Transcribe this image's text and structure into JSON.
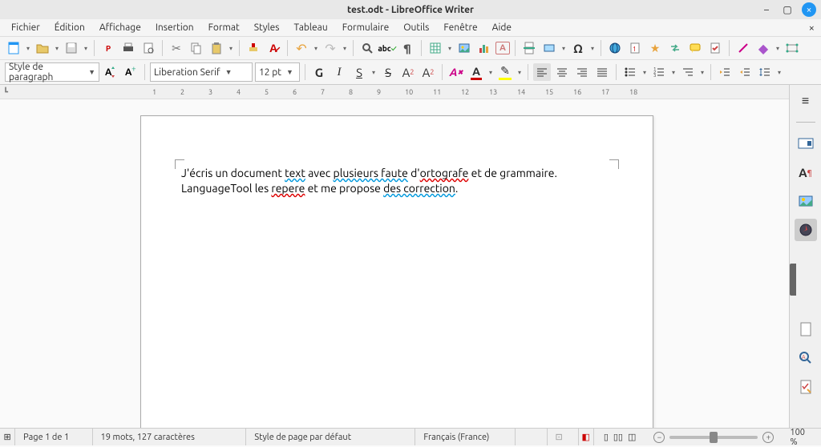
{
  "window": {
    "title": "test.odt - LibreOffice Writer",
    "minimize": "–",
    "maximize": "▢",
    "close": "×"
  },
  "menu": {
    "items": [
      "Fichier",
      "Édition",
      "Affichage",
      "Insertion",
      "Format",
      "Styles",
      "Tableau",
      "Formulaire",
      "Outils",
      "Fenêtre",
      "Aide"
    ],
    "close_doc": "×"
  },
  "format": {
    "para_style": "Style de paragraph",
    "font_name": "Liberation Serif",
    "font_size": "12 pt",
    "bold": "G",
    "italic": "I",
    "underline": "S",
    "strike": "S",
    "superscript": "A",
    "sup2": "2",
    "subscript": "A",
    "sub2": "2",
    "highlight_a": "A",
    "fontcolor_a": "A",
    "hilite": "✎"
  },
  "ruler": {
    "corner": "┗",
    "numbers": [
      "1",
      "2",
      "3",
      "4",
      "5",
      "6",
      "7",
      "8",
      "9",
      "10",
      "11",
      "12",
      "13",
      "14",
      "15",
      "16",
      "17",
      "18"
    ]
  },
  "doc": {
    "line1_parts": [
      "J'écris un document ",
      "text",
      " avec ",
      "plusieurs faute",
      " d'",
      "ortografe",
      " et de grammaire."
    ],
    "line2_parts": [
      "LanguageTool les ",
      "repere",
      " et me propose ",
      "des correction",
      "."
    ]
  },
  "status": {
    "page": "Page 1 de 1",
    "words": "19 mots, 127 caractères",
    "page_style": "Style de page par défaut",
    "language": "Français (France)",
    "insert": "",
    "signature": "",
    "zoom": "100 %"
  },
  "icons": {
    "new": "doc",
    "open": "folder",
    "save": "save",
    "pdf": "PDF",
    "print": "print",
    "preview": "preview",
    "cut": "✂",
    "copy": "⧉",
    "paste": "📋",
    "clone": "🖌",
    "clear": "⨯",
    "undo": "↶",
    "redo": "↷",
    "find": "🔍",
    "spell": "abc",
    "pilcrow": "¶",
    "table": "▦",
    "image": "🖼",
    "chart": "📊",
    "textbox": "A",
    "pagebreak": "⤓",
    "field": "⧉",
    "special": "Ω",
    "hyperlink": "🔗",
    "footnote": "※",
    "bookmark": "★",
    "crossref": "⇄",
    "comment": "💬",
    "trackchanges": "✓",
    "line": "╱",
    "shapes": "◆",
    "show": "▭"
  }
}
